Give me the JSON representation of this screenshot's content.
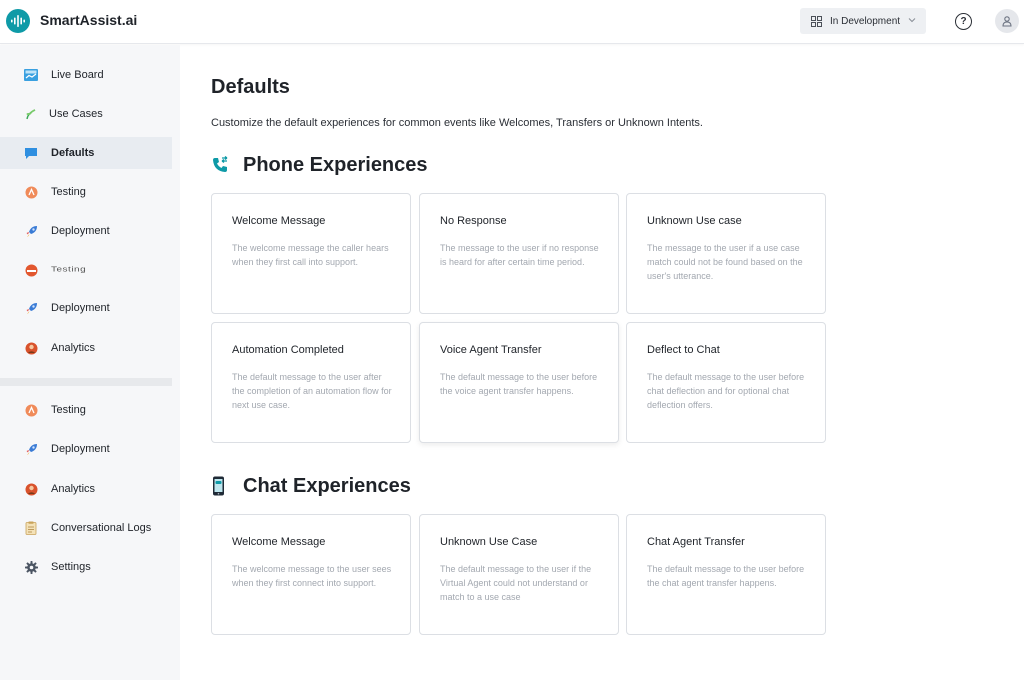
{
  "app": {
    "name": "SmartAssist.ai"
  },
  "header": {
    "environment": "In Development"
  },
  "sidebar": {
    "items": [
      {
        "label": "Live Board",
        "icon": "live-board-icon"
      },
      {
        "label": "Use Cases",
        "icon": "use-cases-icon"
      },
      {
        "label": "Defaults",
        "icon": "defaults-icon",
        "active": true
      },
      {
        "label": "Testing",
        "icon": "testing-icon"
      },
      {
        "label": "Deployment",
        "icon": "rocket-icon"
      },
      {
        "label": "Testing",
        "icon": "testing-icon"
      },
      {
        "label": "Deployment",
        "icon": "rocket-icon"
      },
      {
        "label": "Analytics",
        "icon": "analytics-icon"
      }
    ],
    "lower_items": [
      {
        "label": "Testing",
        "icon": "testing-icon"
      },
      {
        "label": "Deployment",
        "icon": "rocket-icon"
      },
      {
        "label": "Analytics",
        "icon": "analytics-icon"
      },
      {
        "label": "Conversational Logs",
        "icon": "logs-icon"
      },
      {
        "label": "Settings",
        "icon": "gear-icon"
      }
    ]
  },
  "main": {
    "title": "Defaults",
    "description": "Customize the default experiences for common events like Welcomes, Transfers or Unknown Intents.",
    "phone": {
      "title": "Phone Experiences",
      "cards": [
        {
          "title": "Welcome Message",
          "desc": "The welcome message the caller hears when they first call into support."
        },
        {
          "title": "No Response",
          "desc": "The message to the user if no response is heard for after certain time period."
        },
        {
          "title": "Unknown Use case",
          "desc": "The message to the user if a use case match could not be found based on the user's utterance."
        },
        {
          "title": "Automation Completed",
          "desc": "The default message to the user after the completion of an automation flow for next use case."
        },
        {
          "title": "Voice Agent Transfer",
          "desc": "The default message to the user before the voice agent transfer happens."
        },
        {
          "title": "Deflect to Chat",
          "desc": "The default message to the user before chat deflection and for optional chat deflection offers."
        }
      ]
    },
    "chat": {
      "title": "Chat Experiences",
      "cards": [
        {
          "title": "Welcome Message",
          "desc": "The welcome message to the user sees when they first connect into support."
        },
        {
          "title": "Unknown Use Case",
          "desc": "The default message to the user if the Virtual Agent could not understand or match to a use case"
        },
        {
          "title": "Chat Agent Transfer",
          "desc": "The default message to the user before the chat agent transfer happens."
        }
      ]
    }
  },
  "colors": {
    "brand": "#0e9aa7",
    "active_bg": "#e8ecf1",
    "card_border": "#dcdfe4"
  }
}
